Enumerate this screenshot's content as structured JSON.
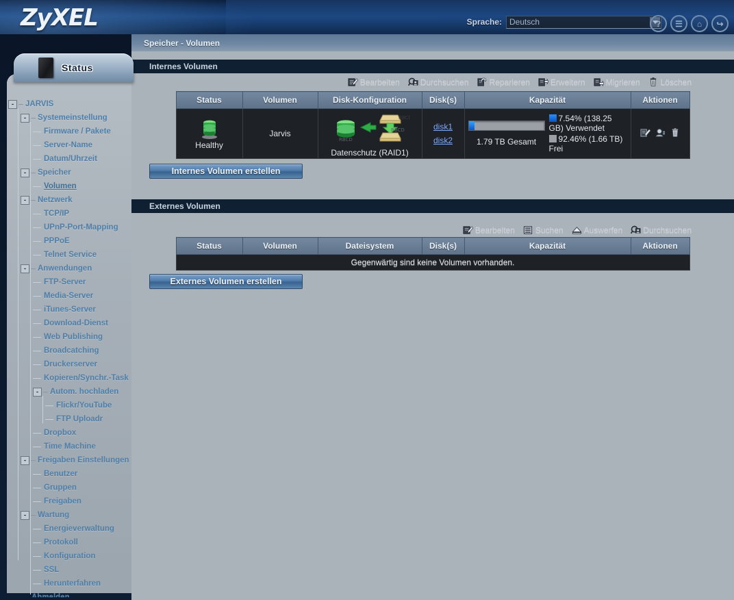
{
  "header": {
    "logo": "ZyXEL",
    "language_label": "Sprache:",
    "language_value": "Deutsch",
    "icons": [
      {
        "name": "help-icon",
        "glyph": "?"
      },
      {
        "name": "log-icon",
        "glyph": "☰"
      },
      {
        "name": "home-icon",
        "glyph": "⌂"
      },
      {
        "name": "logout-icon",
        "glyph": "↪"
      }
    ]
  },
  "sidebar": {
    "status_tab_label": "Status",
    "tree": [
      {
        "label": "JARVIS",
        "level": 0,
        "expander": "-",
        "active": false
      },
      {
        "label": "Systemeinstellung",
        "level": 1,
        "expander": "-",
        "active": false
      },
      {
        "label": "Firmware / Pakete",
        "level": 2,
        "expander": "",
        "active": false
      },
      {
        "label": "Server-Name",
        "level": 2,
        "expander": "",
        "active": false
      },
      {
        "label": "Datum/Uhrzeit",
        "level": 2,
        "expander": "",
        "active": false
      },
      {
        "label": "Speicher",
        "level": 1,
        "expander": "-",
        "active": false
      },
      {
        "label": "Volumen",
        "level": 2,
        "expander": "",
        "active": true
      },
      {
        "label": "Netzwerk",
        "level": 1,
        "expander": "-",
        "active": false
      },
      {
        "label": "TCP/IP",
        "level": 2,
        "expander": "",
        "active": false
      },
      {
        "label": "UPnP-Port-Mapping",
        "level": 2,
        "expander": "",
        "active": false
      },
      {
        "label": "PPPoE",
        "level": 2,
        "expander": "",
        "active": false
      },
      {
        "label": "Telnet Service",
        "level": 2,
        "expander": "",
        "active": false
      },
      {
        "label": "Anwendungen",
        "level": 1,
        "expander": "-",
        "active": false
      },
      {
        "label": "FTP-Server",
        "level": 2,
        "expander": "",
        "active": false
      },
      {
        "label": "Media-Server",
        "level": 2,
        "expander": "",
        "active": false
      },
      {
        "label": "iTunes-Server",
        "level": 2,
        "expander": "",
        "active": false
      },
      {
        "label": "Download-Dienst",
        "level": 2,
        "expander": "",
        "active": false
      },
      {
        "label": "Web Publishing",
        "level": 2,
        "expander": "",
        "active": false
      },
      {
        "label": "Broadcatching",
        "level": 2,
        "expander": "",
        "active": false
      },
      {
        "label": "Druckerserver",
        "level": 2,
        "expander": "",
        "active": false
      },
      {
        "label": "Kopieren/Synchr.-Task",
        "level": 2,
        "expander": "",
        "active": false
      },
      {
        "label": "Autom. hochladen",
        "level": 2,
        "expander": "-",
        "active": false
      },
      {
        "label": "Flickr/YouTube",
        "level": 3,
        "expander": "",
        "active": false
      },
      {
        "label": "FTP Uploadr",
        "level": 3,
        "expander": "",
        "active": false
      },
      {
        "label": "Dropbox",
        "level": 2,
        "expander": "",
        "active": false
      },
      {
        "label": "Time Machine",
        "level": 2,
        "expander": "",
        "active": false
      },
      {
        "label": "Freigaben Einstellungen",
        "level": 1,
        "expander": "-",
        "active": false
      },
      {
        "label": "Benutzer",
        "level": 2,
        "expander": "",
        "active": false
      },
      {
        "label": "Gruppen",
        "level": 2,
        "expander": "",
        "active": false
      },
      {
        "label": "Freigaben",
        "level": 2,
        "expander": "",
        "active": false
      },
      {
        "label": "Wartung",
        "level": 1,
        "expander": "-",
        "active": false
      },
      {
        "label": "Energieverwaltung",
        "level": 2,
        "expander": "",
        "active": false
      },
      {
        "label": "Protokoll",
        "level": 2,
        "expander": "",
        "active": false
      },
      {
        "label": "Konfiguration",
        "level": 2,
        "expander": "",
        "active": false
      },
      {
        "label": "SSL",
        "level": 2,
        "expander": "",
        "active": false
      },
      {
        "label": "Herunterfahren",
        "level": 2,
        "expander": "",
        "active": false
      },
      {
        "label": "Abmelden",
        "level": 1,
        "expander": "",
        "active": false
      }
    ]
  },
  "page": {
    "title": "Speicher - Volumen"
  },
  "internal": {
    "section_title": "Internes Volumen",
    "toolbar": [
      {
        "label": "Bearbeiten",
        "icon": "edit-icon"
      },
      {
        "label": "Durchsuchen",
        "icon": "browse-icon"
      },
      {
        "label": "Reparieren",
        "icon": "repair-icon"
      },
      {
        "label": "Erweitern",
        "icon": "expand-icon"
      },
      {
        "label": "Migrieren",
        "icon": "migrate-icon"
      },
      {
        "label": "Löschen",
        "icon": "trash-icon"
      }
    ],
    "columns": [
      "Status",
      "Volumen",
      "Disk-Konfiguration",
      "Disk(s)",
      "Kapazität",
      "Aktionen"
    ],
    "row": {
      "status": "Healthy",
      "volume": "Jarvis",
      "raid_label": "Datenschutz (RAID1)",
      "disks": [
        "disk1",
        "disk2"
      ],
      "capacity_total": "1.79 TB Gesamt",
      "used_text": "7.54% (138.25 GB) Verwendet",
      "free_text": "92.46% (1.66 TB) Frei",
      "used_percent": 7.54,
      "free_percent": 92.46,
      "actions": [
        "edit-icon",
        "manage-icon",
        "trash-icon"
      ]
    },
    "create_button": "Internes Volumen erstellen"
  },
  "external": {
    "section_title": "Externes Volumen",
    "toolbar": [
      {
        "label": "Bearbeiten",
        "icon": "edit-icon"
      },
      {
        "label": "Suchen",
        "icon": "scan-icon"
      },
      {
        "label": "Auswerfen",
        "icon": "eject-icon"
      },
      {
        "label": "Durchsuchen",
        "icon": "browse-icon"
      }
    ],
    "columns": [
      "Status",
      "Volumen",
      "Dateisystem",
      "Disk(s)",
      "Kapazität",
      "Aktionen"
    ],
    "empty_message": "Gegenwärtig sind keine Volumen vorhanden.",
    "create_button": "Externes Volumen erstellen"
  },
  "colors": {
    "accent_blue": "#1f5fa8",
    "used_blue": "#0b57c8",
    "free_gray": "#9aa0a6",
    "panel_gray": "#aab2ba",
    "table_dark": "#1e2126",
    "link_blue": "#7ea9ff"
  }
}
